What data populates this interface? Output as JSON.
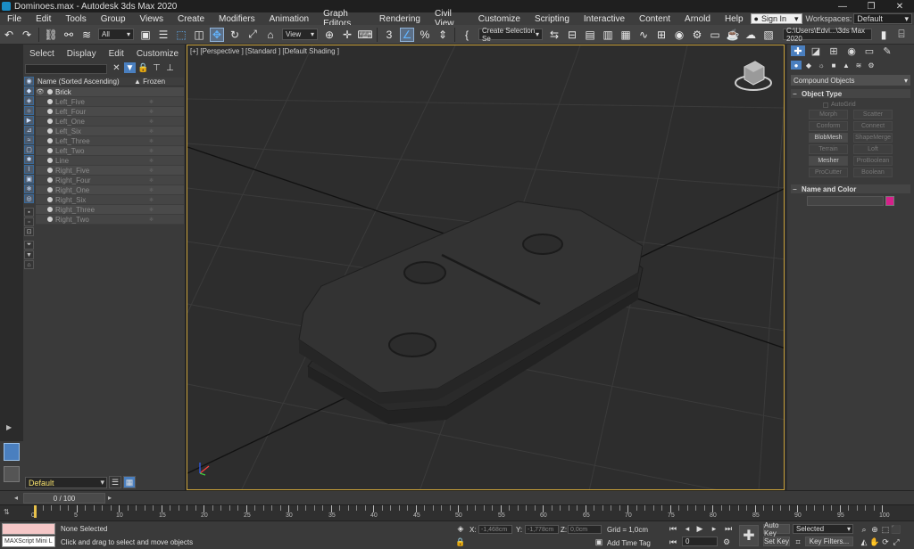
{
  "title_bar": {
    "title": "Dominoes.max - Autodesk 3ds Max 2020",
    "minimize": "—",
    "maximize": "❐",
    "close": "✕"
  },
  "menu": {
    "items": [
      "File",
      "Edit",
      "Tools",
      "Group",
      "Views",
      "Create",
      "Modifiers",
      "Animation",
      "Graph Editors",
      "Rendering",
      "Civil View",
      "Customize",
      "Scripting",
      "Interactive",
      "Content",
      "Arnold",
      "Help"
    ],
    "sign_in": "Sign In",
    "workspaces_label": "Workspaces:",
    "workspaces_value": "Default"
  },
  "toolbar": {
    "selection_filter": "All",
    "reference_coord": "View",
    "named_selection": "Create Selection Se",
    "project_path": "C:\\Users\\Edvi...\\3ds Max 2020"
  },
  "explorer": {
    "menu": [
      "Select",
      "Display",
      "Edit",
      "Customize"
    ],
    "col_name": "Name (Sorted Ascending)",
    "col_frozen": "▲ Frozen",
    "rows": [
      "Brick",
      "Left_Five",
      "Left_Four",
      "Left_One",
      "Left_Six",
      "Left_Three",
      "Left_Two",
      "Line",
      "Right_Five",
      "Right_Four",
      "Right_One",
      "Right_Six",
      "Right_Three",
      "Right_Two"
    ],
    "layer": "Default"
  },
  "viewport": {
    "label": "[+] [Perspective ] [Standard ] [Default Shading ]"
  },
  "command_panel": {
    "category": "Compound Objects",
    "object_type": {
      "header": "Object Type",
      "autogrid": "AutoGrid",
      "buttons": [
        "Morph",
        "Scatter",
        "Conform",
        "Connect",
        "BlobMesh",
        "ShapeMerge",
        "Terrain",
        "Loft",
        "Mesher",
        "ProBoolean",
        "ProCutter",
        "Boolean"
      ],
      "enabled": [
        "BlobMesh",
        "Mesher"
      ]
    },
    "name_color": {
      "header": "Name and Color",
      "swatch": "#d6208a"
    }
  },
  "time": {
    "slider": "0 / 100",
    "ticks": [
      "0",
      "5",
      "10",
      "15",
      "20",
      "25",
      "30",
      "35",
      "40",
      "45",
      "50",
      "55",
      "60",
      "65",
      "70",
      "75",
      "80",
      "85",
      "90",
      "95",
      "100"
    ]
  },
  "status": {
    "maxscript": "MAXScript Mini L",
    "selection": "None Selected",
    "prompt": "Click and drag to select and move objects",
    "x_label": "X:",
    "x_value": "-1,468cm",
    "y_label": "Y:",
    "y_value": "-1,778cm",
    "z_label": "Z:",
    "z_value": "0,0cm",
    "grid": "Grid = 1,0cm",
    "add_time_tag": "Add Time Tag",
    "auto_key": "Auto Key",
    "set_key": "Set Key",
    "selected": "Selected",
    "key_filters": "Key Filters...",
    "frame": "0"
  }
}
